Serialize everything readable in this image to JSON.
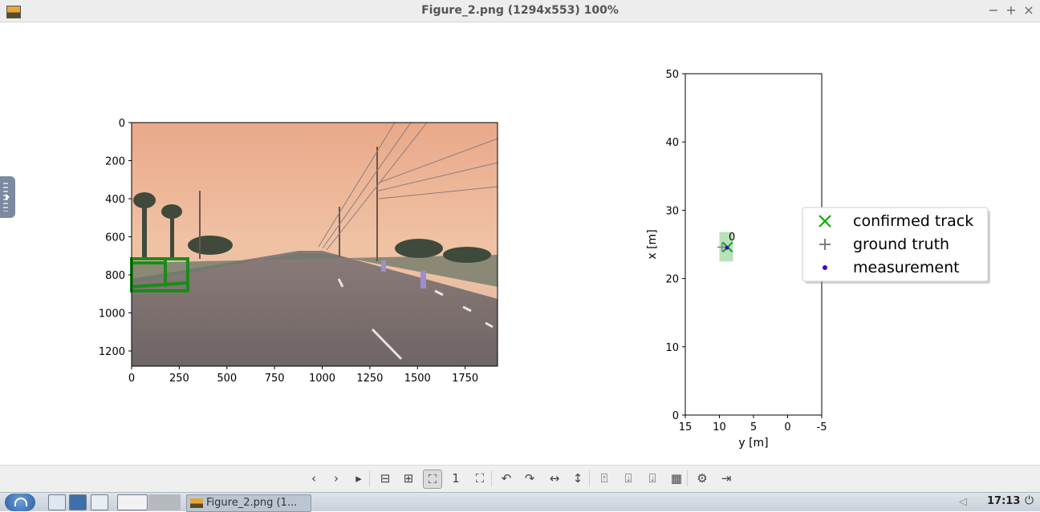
{
  "window": {
    "title": "Figure_2.png (1294x553) 100%",
    "buttons": {
      "minimize": "−",
      "maximize": "+",
      "close": "×"
    }
  },
  "figure": {
    "image_panel": {
      "x_ticks": [
        "0",
        "250",
        "500",
        "750",
        "1000",
        "1250",
        "1500",
        "1750"
      ],
      "y_ticks": [
        "0",
        "200",
        "400",
        "600",
        "800",
        "1000",
        "1200"
      ],
      "scene": "camera image of a multi-lane road at dusk with a green 3D bounding box around a vehicle on the left"
    },
    "chart_data": {
      "type": "scatter",
      "xlabel": "y [m]",
      "ylabel": "x [m]",
      "xlim": [
        15,
        -5
      ],
      "ylim": [
        0,
        50
      ],
      "x_ticks": [
        "15",
        "10",
        "5",
        "0",
        "-5"
      ],
      "y_ticks": [
        "0",
        "10",
        "20",
        "30",
        "40",
        "50"
      ],
      "track_label": "0",
      "series": [
        {
          "name": "confirmed track",
          "marker": "x",
          "color": "#00aa00",
          "points": [
            [
              8.8,
              24.6
            ]
          ]
        },
        {
          "name": "ground truth",
          "marker": "+",
          "color": "#808080",
          "points": [
            [
              9.6,
              24.6
            ]
          ]
        },
        {
          "name": "measurement",
          "marker": "dot",
          "color": "#4400cc",
          "points": [
            [
              8.9,
              24.5
            ]
          ]
        }
      ],
      "uncertainty_box": {
        "y_range": [
          10.0,
          8.0
        ],
        "x_range": [
          22.5,
          26.8
        ],
        "color": "#a6dba6"
      },
      "legend_position": "right"
    }
  },
  "toolbar": {
    "buttons": [
      {
        "name": "previous-button",
        "icon": "‹"
      },
      {
        "name": "next-button",
        "icon": "›"
      },
      {
        "name": "play-button",
        "icon": "▸"
      },
      {
        "name": "zoom-out-button",
        "icon": "⊟"
      },
      {
        "name": "zoom-in-button",
        "icon": "⊞"
      },
      {
        "name": "fit-window-button",
        "icon": "⛶"
      },
      {
        "name": "original-size-button",
        "icon": "1"
      },
      {
        "name": "fullscreen-button",
        "icon": "⛶"
      },
      {
        "name": "rotate-left-button",
        "icon": "↶"
      },
      {
        "name": "rotate-right-button",
        "icon": "↷"
      },
      {
        "name": "flip-horizontal-button",
        "icon": "↔"
      },
      {
        "name": "flip-vertical-button",
        "icon": "↕"
      },
      {
        "name": "open-button",
        "icon": "⍐"
      },
      {
        "name": "save-button",
        "icon": "⍗"
      },
      {
        "name": "save-as-button",
        "icon": "⍗"
      },
      {
        "name": "delete-button",
        "icon": "▦"
      },
      {
        "name": "settings-button",
        "icon": "⚙"
      },
      {
        "name": "exit-button",
        "icon": "⇥"
      }
    ]
  },
  "taskbar": {
    "task_label": "Figure_2.png (1...",
    "clock": "17:13"
  }
}
